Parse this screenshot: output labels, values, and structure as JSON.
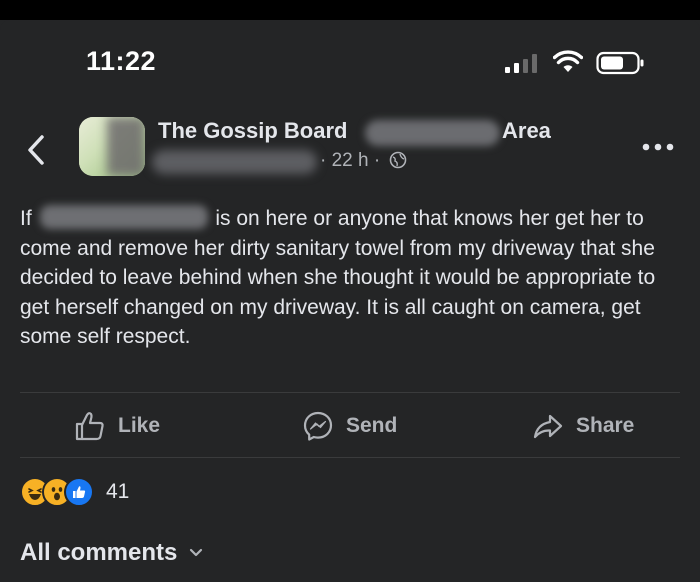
{
  "status_bar": {
    "time": "11:22"
  },
  "post": {
    "group_name": "The Gossip Board",
    "group_name_suffix": "Area",
    "age": "· 22 h ·",
    "text_start": "If",
    "text_rest": "is on here or anyone that knows her get her to come and remove her dirty sanitary towel from my driveway that she decided to leave behind when she thought it would be appropriate to get herself changed on my driveway. It is all caught on camera, get some self respect."
  },
  "actions": {
    "like": "Like",
    "send": "Send",
    "share": "Share"
  },
  "reactions": {
    "count": "41",
    "icons": [
      "haha-icon",
      "wow-icon",
      "like-reaction-icon"
    ]
  },
  "comments": {
    "label": "All comments"
  },
  "colors": {
    "background": "#242526",
    "text": "#e4e6eb",
    "muted": "#b0b3b8",
    "like_blue": "#1877f2",
    "emoji_yellow": "#f7b125"
  }
}
